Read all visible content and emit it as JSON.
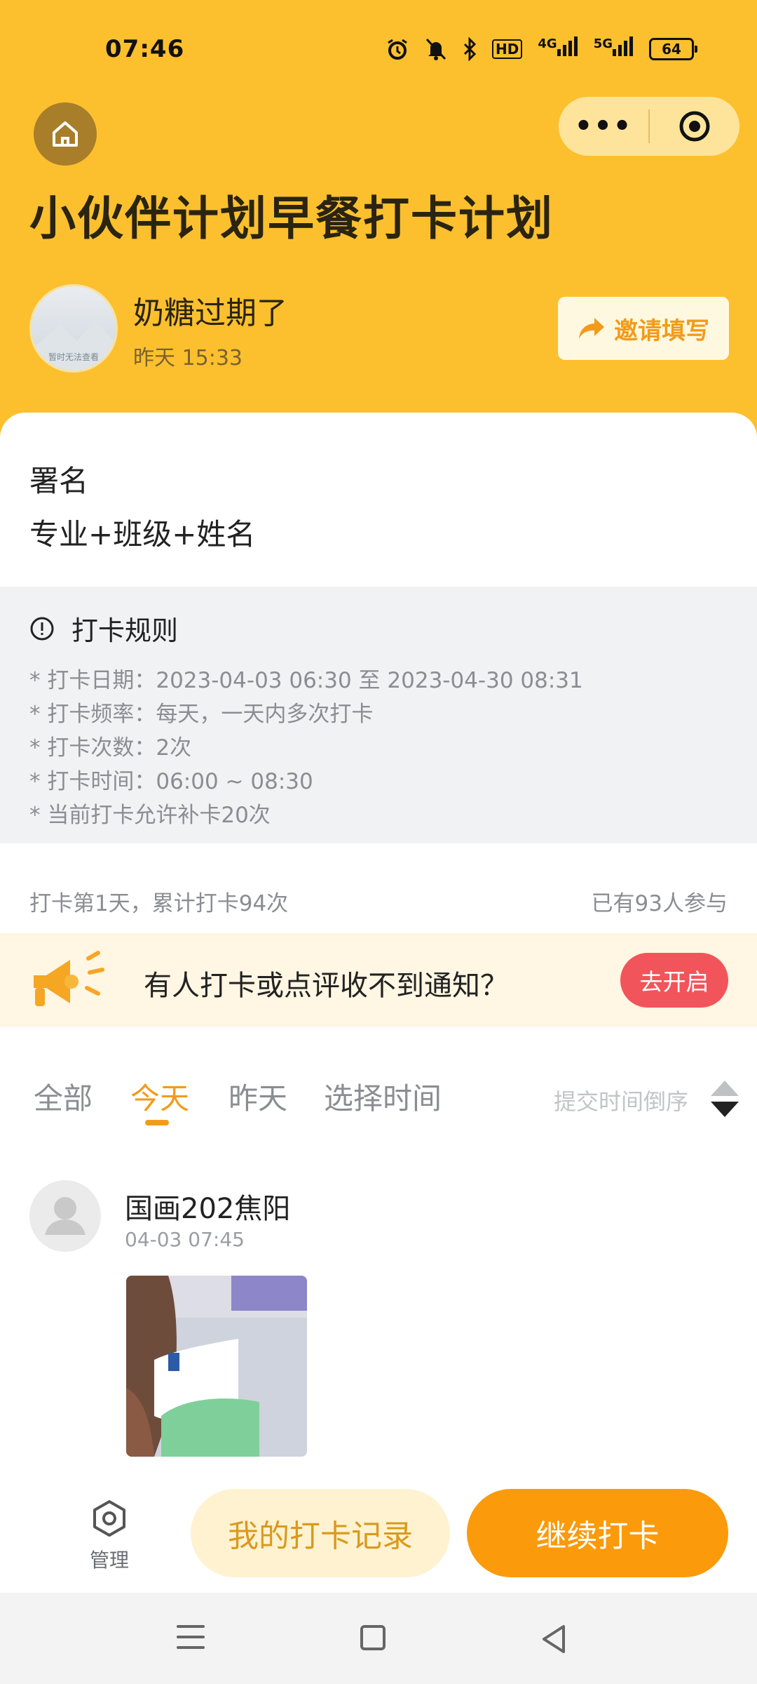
{
  "status_bar": {
    "time": "07:46",
    "network_1": "4G",
    "network_2": "5G",
    "hd": "HD",
    "battery": "64"
  },
  "capsule": {
    "more": "•••"
  },
  "plan": {
    "title": "小伙伴计划早餐打卡计划",
    "author_name": "奶糖过期了",
    "author_time": "昨天 15:33",
    "avatar_caption": "暂时无法查看",
    "invite_label": "邀请填写"
  },
  "signature": {
    "title": "署名",
    "desc": "专业+班级+姓名"
  },
  "rules": {
    "heading": "打卡规则",
    "lines": [
      "* 打卡日期：2023-04-03 06:30 至 2023-04-30 08:31",
      "* 打卡频率：每天，一天内多次打卡",
      "* 打卡次数：2次",
      "* 打卡时间：06:00 ~ 08:30",
      "* 当前打卡允许补卡20次"
    ]
  },
  "stats": {
    "left": "打卡第1天，累计打卡94次",
    "right": "已有93人参与"
  },
  "notify": {
    "text": "有人打卡或点评收不到通知？",
    "button": "去开启"
  },
  "filters": {
    "tabs": [
      "全部",
      "今天",
      "昨天",
      "选择时间"
    ],
    "active_index": 1,
    "sort_label": "提交时间倒序"
  },
  "post": {
    "name": "国画202焦阳",
    "time": "04-03 07:45"
  },
  "actions": {
    "manage": "管理",
    "records": "我的打卡记录",
    "continue": "继续打卡"
  },
  "colors": {
    "header_yellow": "#fcc02e",
    "accent_orange": "#fb9a0a",
    "notify_red": "#f2545b"
  }
}
